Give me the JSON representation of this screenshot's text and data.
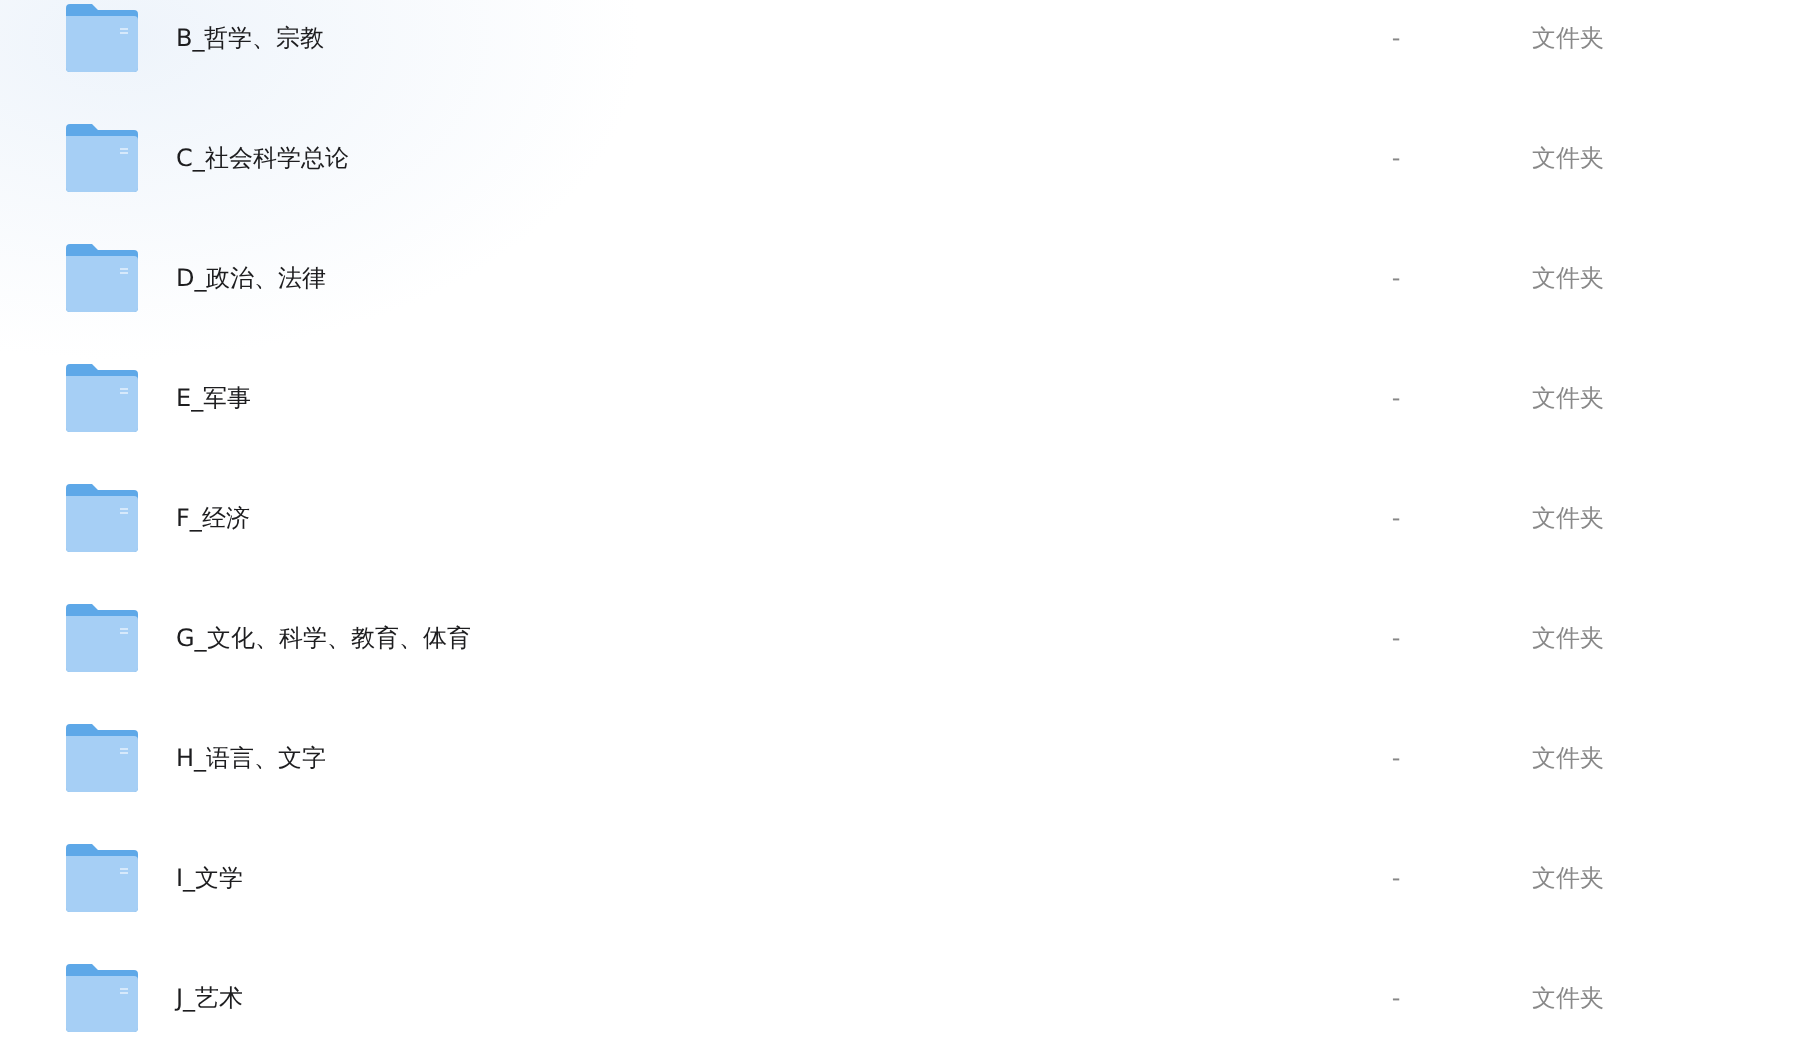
{
  "files": [
    {
      "name": "B_哲学、宗教",
      "size": "-",
      "type": "文件夹"
    },
    {
      "name": "C_社会科学总论",
      "size": "-",
      "type": "文件夹"
    },
    {
      "name": "D_政治、法律",
      "size": "-",
      "type": "文件夹"
    },
    {
      "name": "E_军事",
      "size": "-",
      "type": "文件夹"
    },
    {
      "name": "F_经济",
      "size": "-",
      "type": "文件夹"
    },
    {
      "name": "G_文化、科学、教育、体育",
      "size": "-",
      "type": "文件夹"
    },
    {
      "name": "H_语言、文字",
      "size": "-",
      "type": "文件夹"
    },
    {
      "name": "I_文学",
      "size": "-",
      "type": "文件夹"
    },
    {
      "name": "J_艺术",
      "size": "-",
      "type": "文件夹"
    }
  ]
}
